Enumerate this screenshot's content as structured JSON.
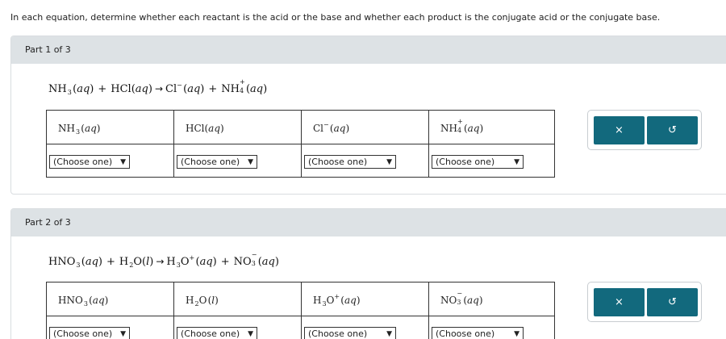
{
  "instructions": "In each equation, determine whether each reactant is the acid or the base and whether each product is the conjugate acid or the conjugate base.",
  "parts": [
    {
      "label": "Part 1 of 3",
      "reactants": [
        {
          "formula": "NH",
          "sub": "3",
          "phase": "aq"
        },
        {
          "formula": "HCl",
          "sub": "",
          "phase": "aq"
        }
      ],
      "products": [
        {
          "formula": "Cl",
          "sup": "−",
          "phase": "aq"
        },
        {
          "formula": "NH",
          "sub": "4",
          "sup": "+",
          "phase": "aq"
        }
      ],
      "dropdown_value": "(Choose one)"
    },
    {
      "label": "Part 2 of 3",
      "reactants": [
        {
          "formula": "HNO",
          "sub": "3",
          "phase": "aq"
        },
        {
          "formula": "H",
          "sub": "2",
          "suffix": "O",
          "phase": "l"
        }
      ],
      "products": [
        {
          "formula": "H",
          "sub": "3",
          "suffix": "O",
          "sup": "+",
          "phase": "aq"
        },
        {
          "formula": "NO",
          "sub": "3",
          "sup": "−",
          "phase": "aq"
        }
      ],
      "dropdown_value": "(Choose one)"
    }
  ],
  "buttons": {
    "clear_icon": "×",
    "undo_icon": "↺"
  },
  "colors": {
    "header_bg": "#dde2e5",
    "button_bg": "#12697d"
  }
}
